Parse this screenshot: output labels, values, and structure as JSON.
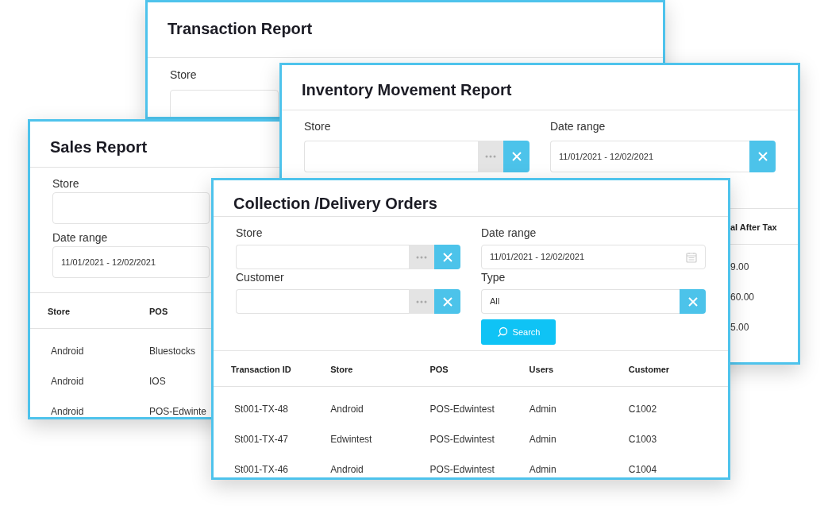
{
  "windows": [
    {
      "title": "Transaction Report",
      "fields": [
        {
          "label": "Store",
          "kind": "plain"
        }
      ]
    },
    {
      "title": "Sales Report",
      "fields": [
        {
          "label": "Store",
          "kind": "plain"
        },
        {
          "label": "Date range",
          "kind": "plain",
          "value": "11/01/2021 - 12/02/2021"
        }
      ],
      "table": {
        "columns": [
          "Store",
          "POS"
        ],
        "rows": [
          [
            "Android",
            "Bluestocks"
          ],
          [
            "Android",
            "IOS"
          ],
          [
            "Android",
            "POS-Edwinte"
          ]
        ]
      }
    },
    {
      "title": "Inventory Movement Report",
      "fields": [
        {
          "label": "Store",
          "kind": "lookup"
        },
        {
          "label": "Date range",
          "kind": "select",
          "value": "11/01/2021 - 12/02/2021"
        }
      ],
      "table": {
        "columns": [
          "al After Tax"
        ],
        "rows": [
          [
            "9.00"
          ],
          [
            "60.00"
          ],
          [
            "5.00"
          ]
        ]
      }
    },
    {
      "title": "Collection /Delivery Orders",
      "fields": [
        {
          "label": "Store",
          "kind": "lookup"
        },
        {
          "label": "Date range",
          "kind": "date",
          "value": "11/01/2021 - 12/02/2021"
        },
        {
          "label": "Customer",
          "kind": "lookup"
        },
        {
          "label": "Type",
          "kind": "select",
          "value": "All"
        }
      ],
      "button": "Search",
      "table": {
        "columns": [
          "Transaction ID",
          "Store",
          "POS",
          "Users",
          "Customer"
        ],
        "rows": [
          [
            "St001-TX-48",
            "Android",
            "POS-Edwintest",
            "Admin",
            "C1002"
          ],
          [
            "St001-TX-47",
            "Edwintest",
            "POS-Edwintest",
            "Admin",
            "C1003"
          ],
          [
            "St001-TX-46",
            "Android",
            "POS-Edwintest",
            "Admin",
            "C1004"
          ]
        ]
      }
    }
  ]
}
